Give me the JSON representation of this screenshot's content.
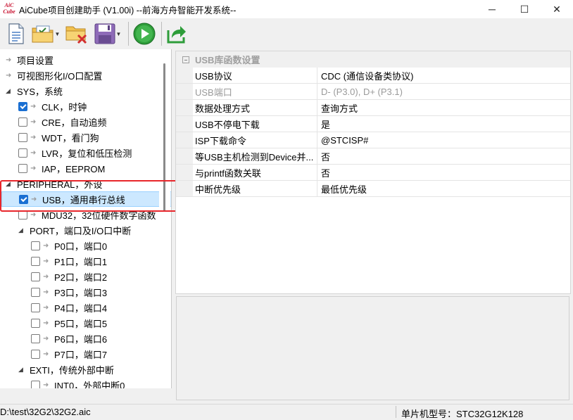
{
  "window": {
    "title": "AiCube项目创建助手 (V1.00i) --前海方舟智能开发系统--",
    "logo_text": "AiC Cube",
    "controls": {
      "minimize": "─",
      "maximize": "☐",
      "close": "✕"
    }
  },
  "toolbar": {
    "buttons": [
      "new-file-icon",
      "open-project-icon",
      "close-project-icon",
      "save-icon",
      "run-icon",
      "export-icon"
    ]
  },
  "tree": {
    "items": [
      {
        "label": "项目设置",
        "kind": "arrow",
        "level": 0
      },
      {
        "label": "可视图形化I/O口配置",
        "kind": "arrow",
        "level": 0
      },
      {
        "label": "SYS，系统",
        "kind": "expanded",
        "level": 0
      },
      {
        "label": "CLK，时钟",
        "kind": "check",
        "checked": true,
        "level": 1
      },
      {
        "label": "CRE，自动追频",
        "kind": "check",
        "checked": false,
        "level": 1
      },
      {
        "label": "WDT，看门狗",
        "kind": "check",
        "checked": false,
        "level": 1
      },
      {
        "label": "LVR，复位和低压检测",
        "kind": "check",
        "checked": false,
        "level": 1
      },
      {
        "label": "IAP，EEPROM",
        "kind": "check",
        "checked": false,
        "level": 1
      },
      {
        "label": "PERIPHERAL，外设",
        "kind": "expanded",
        "level": 0
      },
      {
        "label": "USB，通用串行总线",
        "kind": "check",
        "checked": true,
        "level": 1,
        "selected": true
      },
      {
        "label": "MDU32，32位硬件数字函数",
        "kind": "check",
        "checked": false,
        "level": 1
      },
      {
        "label": "PORT，端口及I/O口中断",
        "kind": "expanded",
        "level": 1
      },
      {
        "label": "P0口，端口0",
        "kind": "check",
        "checked": false,
        "level": 2
      },
      {
        "label": "P1口，端口1",
        "kind": "check",
        "checked": false,
        "level": 2
      },
      {
        "label": "P2口，端口2",
        "kind": "check",
        "checked": false,
        "level": 2
      },
      {
        "label": "P3口，端口3",
        "kind": "check",
        "checked": false,
        "level": 2
      },
      {
        "label": "P4口，端口4",
        "kind": "check",
        "checked": false,
        "level": 2
      },
      {
        "label": "P5口，端口5",
        "kind": "check",
        "checked": false,
        "level": 2
      },
      {
        "label": "P6口，端口6",
        "kind": "check",
        "checked": false,
        "level": 2
      },
      {
        "label": "P7口，端口7",
        "kind": "check",
        "checked": false,
        "level": 2
      },
      {
        "label": "EXTI，传统外部中断",
        "kind": "expanded",
        "level": 1
      },
      {
        "label": "INT0，外部中断0",
        "kind": "check",
        "checked": false,
        "level": 2
      }
    ]
  },
  "properties": {
    "group_title": "USB库函数设置",
    "rows": [
      {
        "label": "USB协议",
        "value": "CDC (通信设备类协议)",
        "disabled": false
      },
      {
        "label": "USB端口",
        "value": "D- (P3.0), D+ (P3.1)",
        "disabled": true
      },
      {
        "label": "数据处理方式",
        "value": "查询方式",
        "disabled": false
      },
      {
        "label": "USB不停电下载",
        "value": "是",
        "disabled": false
      },
      {
        "label": "ISP下载命令",
        "value": "@STCISP#",
        "disabled": false
      },
      {
        "label": "等USB主机检测到Device并...",
        "value": "否",
        "disabled": false
      },
      {
        "label": "与printf函数关联",
        "value": "否",
        "disabled": false
      },
      {
        "label": "中断优先级",
        "value": "最低优先级",
        "disabled": false
      }
    ]
  },
  "status": {
    "path": "D:\\test\\32G2\\32G2.aic",
    "chip": "单片机型号：STC32G12K128"
  }
}
